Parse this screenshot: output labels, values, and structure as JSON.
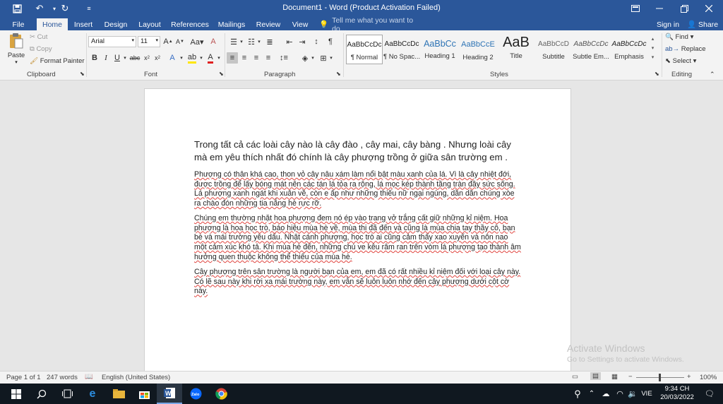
{
  "window": {
    "title": "Document1 - Word (Product Activation Failed)"
  },
  "tabs": [
    {
      "label": "File"
    },
    {
      "label": "Home",
      "active": true
    },
    {
      "label": "Insert"
    },
    {
      "label": "Design"
    },
    {
      "label": "Layout"
    },
    {
      "label": "References"
    },
    {
      "label": "Mailings"
    },
    {
      "label": "Review"
    },
    {
      "label": "View"
    }
  ],
  "tell_me": {
    "placeholder": "Tell me what you want to do..."
  },
  "account": {
    "signin": "Sign in",
    "share": "Share"
  },
  "clipboard": {
    "paste": "Paste",
    "cut": "Cut",
    "copy": "Copy",
    "format_painter": "Format Painter",
    "label": "Clipboard"
  },
  "font": {
    "name": "Arial",
    "size": "11",
    "label": "Font"
  },
  "paragraph": {
    "label": "Paragraph"
  },
  "styles": {
    "label": "Styles",
    "items": [
      {
        "preview": "AaBbCcDc",
        "name": "¶ Normal"
      },
      {
        "preview": "AaBbCcDc",
        "name": "¶ No Spac..."
      },
      {
        "preview": "AaBbCc",
        "name": "Heading 1"
      },
      {
        "preview": "AaBbCcE",
        "name": "Heading 2"
      },
      {
        "preview": "AaB",
        "name": "Title"
      },
      {
        "preview": "AaBbCcD",
        "name": "Subtitle"
      },
      {
        "preview": "AaBbCcDc",
        "name": "Subtle Em..."
      },
      {
        "preview": "AaBbCcDc",
        "name": "Emphasis"
      }
    ]
  },
  "editing": {
    "find": "Find",
    "replace": "Replace",
    "select": "Select",
    "label": "Editing"
  },
  "document": {
    "p1": "Trong tất cả các loài cây nào là cây đào , cây mai, cây bàng . Nhưng loài cây mà em yêu thích nhất đó chính là cây phượng  trồng ở giữa sân trường em .",
    "p2": "Phượng có thân khá cao, thon vỏ cây nâu xám làm nổi bật màu xanh của lá. Vì là cây nhiệt đới, được trồng để lấy bóng mát nên các tán lá tỏa ra rộng, lá mọc kép thành tầng tràn đầy sức sống. Lá phượng xanh ngát khi xuân về, còn e ấp như những thiếu nữ ngại ngùng, dần dần chúng xòe ra chào đón những tia nắng hè rực rỡ.",
    "p3": "Chúng em thường nhặt hoa phượng đem nó ép vào trang vở trắng cất giữ những kỉ niệm. Hoa phượng là hoa học trò, báo hiệu mùa hè về, mùa thi đã đến và cũng là mùa chia tay thầy cô, bạn bè và mái trường yêu dấu. Nhặt cánh phượng, học trò ai cũng cảm thấy xao xuyến và nôn nao một cảm xúc khó tả. Khi mùa hè đến, những chú ve kêu râm ran trên vòm lá phượng tạo thành âm hưởng quen thuộc không thể thiếu của mùa hè.",
    "p4": "Cây phượng trên sân trường là người bạn của em, em đã có rất nhiều kỉ niệm đối với loại cây này. Có lẽ sau này khi rời xa mái trường này, em vẫn sẽ luôn luôn nhớ đến cây phượng dưới cột cờ này."
  },
  "status": {
    "page": "Page 1 of 1",
    "words": "247 words",
    "language": "English (United States)",
    "zoom": "100%"
  },
  "watermark": {
    "line1": "Activate Windows",
    "line2": "Go to Settings to activate Windows."
  },
  "taskbar": {
    "lang": "VIE",
    "time": "9:34 CH",
    "date": "20/03/2022"
  }
}
